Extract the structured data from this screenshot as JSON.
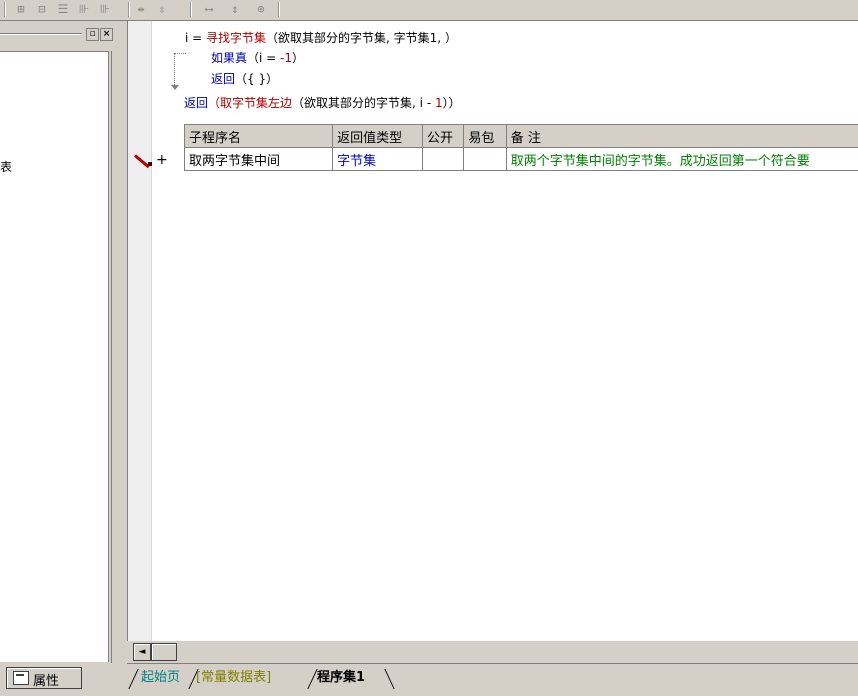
{
  "toolbar": {
    "buttons": [
      {
        "name": "align-left-icon",
        "glyph": "⊞"
      },
      {
        "name": "align-center-icon",
        "glyph": "⊟"
      },
      {
        "name": "align-top-icon",
        "glyph": "☰"
      },
      {
        "name": "align-right-icon",
        "glyph": "⊪"
      },
      {
        "name": "same-width-icon",
        "glyph": "⇹"
      },
      {
        "name": "same-height-icon",
        "glyph": "⇳"
      },
      {
        "name": "hspace-icon",
        "glyph": "⟷"
      },
      {
        "name": "vspace-icon",
        "glyph": "↕"
      },
      {
        "name": "center-form-icon",
        "glyph": "⊕"
      }
    ]
  },
  "left_panel": {
    "minimize_glyph": "▫",
    "close_glyph": "×",
    "tree_fragment": "表",
    "properties_tab_label": "属性"
  },
  "code": {
    "line1": {
      "a": "i = ",
      "fn": "寻找字节集",
      "args": "（欲取其部分的字节集, 字节集1, ）"
    },
    "line2": {
      "kw": "如果真",
      "cond": "（i = ",
      "num": "-1",
      "close": "）"
    },
    "line3": {
      "kw": "返回",
      "args": "（{ }）"
    },
    "line4": {
      "kw": "返回",
      "open": "（",
      "fn": "取字节集左边",
      "args": "（欲取其部分的字节集, i - ",
      "num": "1",
      "close": "））"
    }
  },
  "table": {
    "headers": [
      "子程序名",
      "返回值类型",
      "公开",
      "易包",
      "备 注"
    ],
    "row": {
      "name": "取两字节集中间",
      "return_type": "字节集",
      "public": "",
      "easy_pack": "",
      "remark": "取两个字节集中间的字节集。成功返回第一个符合要"
    }
  },
  "gutter": {
    "plus": "+"
  },
  "scrollbar": {
    "left_arrow": "◄"
  },
  "tabs": [
    {
      "label": "起始页"
    },
    {
      "label": "[常量数据表]"
    },
    {
      "label": "程序集1"
    }
  ]
}
